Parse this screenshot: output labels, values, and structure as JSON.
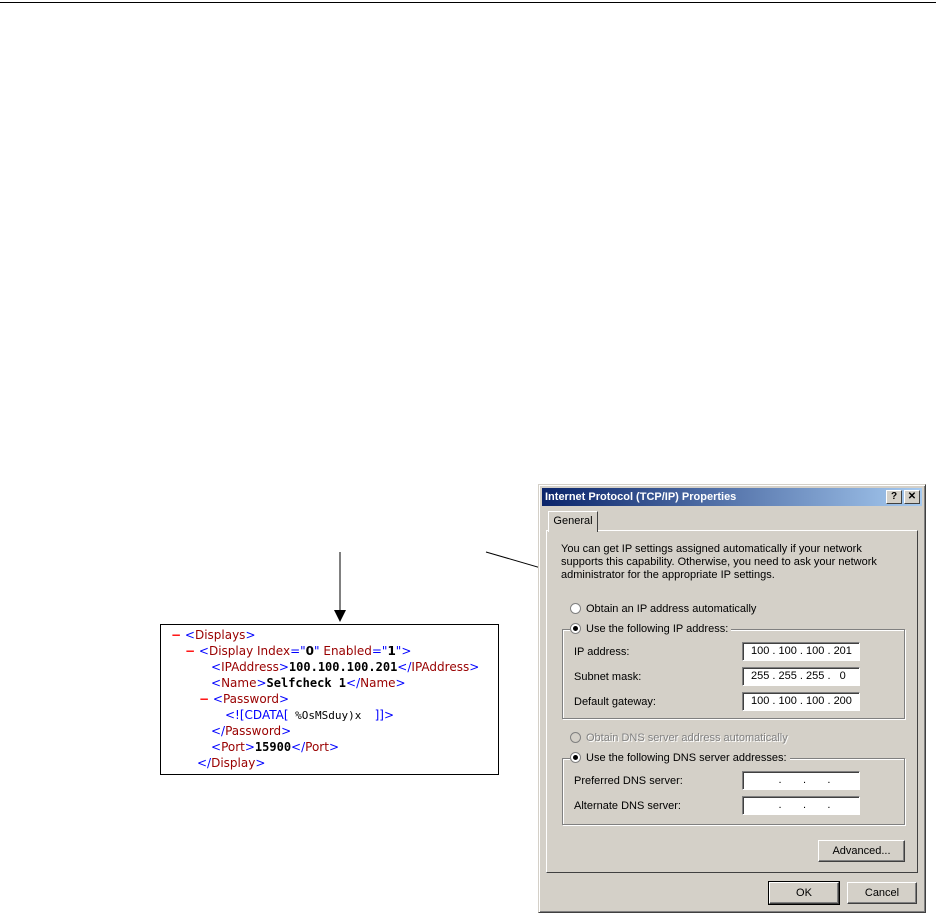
{
  "xml": {
    "minus": "−",
    "displays_tag": "Displays",
    "display_tag": "Display",
    "attr_index_name": "Index",
    "attr_index_value": "0",
    "attr_enabled_name": "Enabled",
    "attr_enabled_value": "1",
    "ipaddress_tag": "IPAddress",
    "ipaddress_value": "100.100.100.201",
    "name_tag": "Name",
    "name_value": "Selfcheck 1",
    "password_tag": "Password",
    "cdata_open": "<![CDATA[",
    "cdata_body": " %OsMSduy)x  ",
    "cdata_close": "]]>",
    "port_tag": "Port",
    "port_value": "15900"
  },
  "dialog": {
    "title": "Internet Protocol (TCP/IP) Properties",
    "help_btn": "?",
    "close_btn": "✕",
    "tab_general": "General",
    "description": "You can get IP settings assigned automatically if your network supports this capability. Otherwise, you need to ask your network administrator for the appropriate IP settings.",
    "radio_auto_ip": "Obtain an IP address automatically",
    "radio_manual_ip": "Use the following IP address:",
    "ip_label": "IP address:",
    "ip_value": "100 . 100 . 100 . 201",
    "subnet_label": "Subnet mask:",
    "subnet_value": "255 . 255 . 255 .   0",
    "gateway_label": "Default gateway:",
    "gateway_value": "100 . 100 . 100 . 200",
    "radio_auto_dns": "Obtain DNS server address automatically",
    "radio_manual_dns": "Use the following DNS server addresses:",
    "preferred_dns_label": "Preferred DNS server:",
    "preferred_dns_value": "         .       .       .",
    "alternate_dns_label": "Alternate DNS server:",
    "alternate_dns_value": "         .       .       .",
    "advanced_btn": "Advanced...",
    "ok_btn": "OK",
    "cancel_btn": "Cancel"
  },
  "colors": {
    "titlebar_start": "#0a246a",
    "titlebar_end": "#a6caf0",
    "dialog_face": "#d4d0c8",
    "xml_tag": "#990000",
    "xml_punct": "#0000ff",
    "xml_minus": "#ff0000"
  }
}
